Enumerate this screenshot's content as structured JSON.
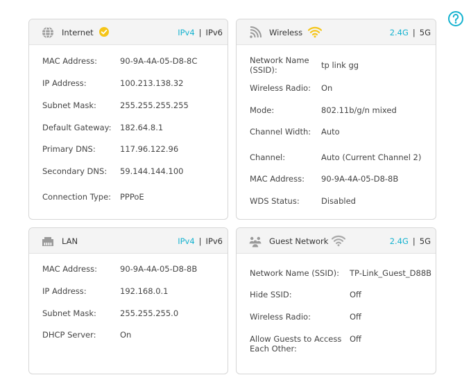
{
  "colors": {
    "accent": "#14b2cf",
    "check": "#f5c518",
    "wifi_active": "#f5c518",
    "icon_gray": "#9a9a9a"
  },
  "internet": {
    "title": "Internet",
    "status_icon": "check-circle-icon",
    "ipv4": "IPv4",
    "separator": "|",
    "ipv6": "IPv6",
    "rows": [
      {
        "label": "MAC Address:",
        "value": "90-9A-4A-05-D8-8C"
      },
      {
        "label": "IP Address:",
        "value": "100.213.138.32"
      },
      {
        "label": "Subnet Mask:",
        "value": "255.255.255.255"
      },
      {
        "label": "Default Gateway:",
        "value": "182.64.8.1"
      },
      {
        "label": "Primary DNS:",
        "value": "117.96.122.96"
      },
      {
        "label": "Secondary DNS:",
        "value": "59.144.144.100"
      },
      {
        "label": "Connection Type:",
        "value": "PPPoE"
      }
    ]
  },
  "wireless": {
    "title": "Wireless",
    "band_24": "2.4G",
    "separator": "|",
    "band_5": "5G",
    "rows": [
      {
        "label": "Network Name (SSID):",
        "value": "tp link gg"
      },
      {
        "label": "Wireless Radio:",
        "value": "On"
      },
      {
        "label": "Mode:",
        "value": "802.11b/g/n mixed"
      },
      {
        "label": "Channel Width:",
        "value": "Auto"
      },
      {
        "label": "Channel:",
        "value": "Auto (Current Channel 2)"
      },
      {
        "label": "MAC Address:",
        "value": "90-9A-4A-05-D8-8B"
      },
      {
        "label": "WDS Status:",
        "value": "Disabled"
      }
    ]
  },
  "lan": {
    "title": "LAN",
    "ipv4": "IPv4",
    "separator": "|",
    "ipv6": "IPv6",
    "rows": [
      {
        "label": "MAC Address:",
        "value": "90-9A-4A-05-D8-8B"
      },
      {
        "label": "IP Address:",
        "value": "192.168.0.1"
      },
      {
        "label": "Subnet Mask:",
        "value": "255.255.255.0"
      },
      {
        "label": "DHCP Server:",
        "value": "On"
      }
    ]
  },
  "guest": {
    "title": "Guest Network",
    "band_24": "2.4G",
    "separator": "|",
    "band_5": "5G",
    "rows": [
      {
        "label": "Network Name (SSID):",
        "value": "TP-Link_Guest_D88B"
      },
      {
        "label": "Hide SSID:",
        "value": "Off"
      },
      {
        "label": "Wireless Radio:",
        "value": "Off"
      },
      {
        "label": "Allow Guests to Access Each Other:",
        "value": "Off"
      }
    ]
  }
}
